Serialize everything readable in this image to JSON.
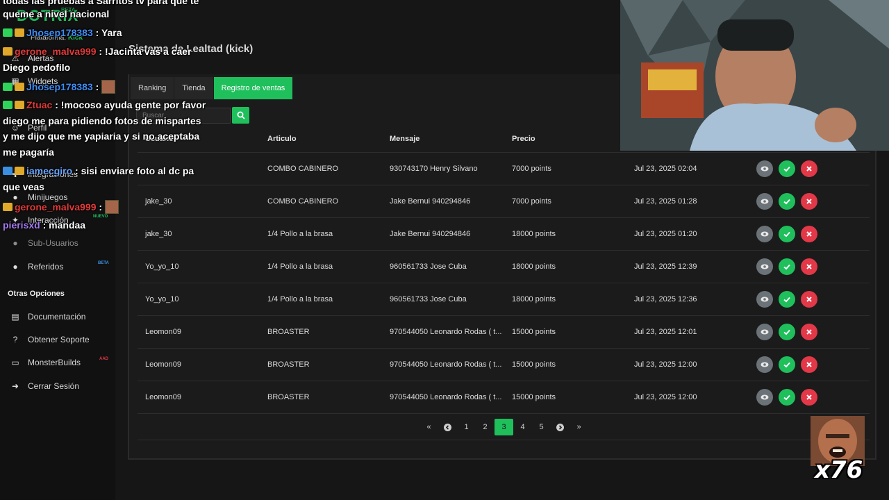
{
  "sidebar": {
    "brand": "DOTRIX",
    "brand_tag": "BETA",
    "platform_label": "Plataforma:",
    "platform_value": "Kick",
    "items": [
      {
        "label": "Alertas"
      },
      {
        "label": "Widgets"
      },
      {
        "label": "Perfil"
      },
      {
        "label": "Integraciones"
      },
      {
        "label": "Minijuegos"
      },
      {
        "label": "Interacción",
        "tag": "NUEVO"
      },
      {
        "label": "Sub-Usuarios"
      },
      {
        "label": "Referidos",
        "tag": "BETA"
      }
    ],
    "section_title": "Otras Opciones",
    "other_items": [
      {
        "label": "Documentación"
      },
      {
        "label": "Obtener Soporte"
      },
      {
        "label": "MonsterBuilds",
        "tag": "AAD"
      },
      {
        "label": "Cerrar Sesión"
      }
    ]
  },
  "page": {
    "title": "Sistema de Lealtad (kick)"
  },
  "tabs": [
    {
      "label": "Ranking",
      "active": false
    },
    {
      "label": "Tienda",
      "active": false
    },
    {
      "label": "Registro de ventas",
      "active": true
    }
  ],
  "search": {
    "placeholder": "Buscar"
  },
  "table": {
    "headers": [
      "Usuario",
      "Articulo",
      "Mensaje",
      "Precio",
      ""
    ],
    "rows": [
      {
        "user": "",
        "article": "COMBO CABINERO",
        "message": "930743170 Henry Silvano",
        "price": "7000 points",
        "date": "Jul 23, 2025 02:04"
      },
      {
        "user": "jake_30",
        "article": "COMBO CABINERO",
        "message": "Jake Bernui 940294846",
        "price": "7000 points",
        "date": "Jul 23, 2025 01:28"
      },
      {
        "user": "jake_30",
        "article": "1/4 Pollo a la brasa",
        "message": "Jake Bernui 940294846",
        "price": "18000 points",
        "date": "Jul 23, 2025 01:20"
      },
      {
        "user": "Yo_yo_10",
        "article": "1/4 Pollo a la brasa",
        "message": "960561733 Jose Cuba",
        "price": "18000 points",
        "date": "Jul 23, 2025 12:39"
      },
      {
        "user": "Yo_yo_10",
        "article": "1/4 Pollo a la brasa",
        "message": "960561733 Jose Cuba",
        "price": "18000 points",
        "date": "Jul 23, 2025 12:36"
      },
      {
        "user": "Leomon09",
        "article": "BROASTER",
        "message": "970544050 Leonardo Rodas ( t...",
        "price": "15000 points",
        "date": "Jul 23, 2025 12:01"
      },
      {
        "user": "Leomon09",
        "article": "BROASTER",
        "message": "970544050 Leonardo Rodas ( t...",
        "price": "15000 points",
        "date": "Jul 23, 2025 12:00"
      },
      {
        "user": "Leomon09",
        "article": "BROASTER",
        "message": "970544050 Leonardo Rodas ( t...",
        "price": "15000 points",
        "date": "Jul 23, 2025 12:00"
      }
    ]
  },
  "pagination": {
    "first": "«",
    "prev": "‹",
    "pages": [
      "1",
      "2",
      "3",
      "4",
      "5"
    ],
    "current": "3",
    "next": "›",
    "last": "»"
  },
  "chat": {
    "messages": [
      {
        "user": "",
        "text": "todas las pruebas a Sarritos tv para que te"
      },
      {
        "user": "",
        "text": "queme a nivel nacional"
      },
      {
        "user": "Jhosep178383",
        "sep": " : ",
        "text": "Yara"
      },
      {
        "user": "gerone_malva999",
        "sep": " : ",
        "text": "!Jacinta vas a caer"
      },
      {
        "user": "",
        "text": "Diego pedofilo"
      },
      {
        "user": "Jhosep178383",
        "sep": " : ",
        "text": ""
      },
      {
        "user": "Ztuac",
        "sep": " : ",
        "text": "!mocoso ayuda gente por favor"
      },
      {
        "user": "",
        "text": "diego me para pidiendo fotos de mispartes"
      },
      {
        "user": "",
        "text": "y me dijo que me yapiaria y si no aceptaba"
      },
      {
        "user": "",
        "text": "me pagaría"
      },
      {
        "user": "iamecgiro",
        "sep": " : ",
        "text": "sisi enviare foto al dc pa"
      },
      {
        "user": "",
        "text": "que veas"
      },
      {
        "user": "gerone_malva999",
        "sep": " : ",
        "text": ""
      },
      {
        "user": "pierisxd",
        "sep": " : ",
        "text": "mandaa"
      }
    ]
  },
  "overlay": {
    "combo_count": "x76"
  },
  "colors": {
    "accent": "#1fbf5c",
    "danger": "#e23848",
    "neutral_button": "#6b7378"
  }
}
